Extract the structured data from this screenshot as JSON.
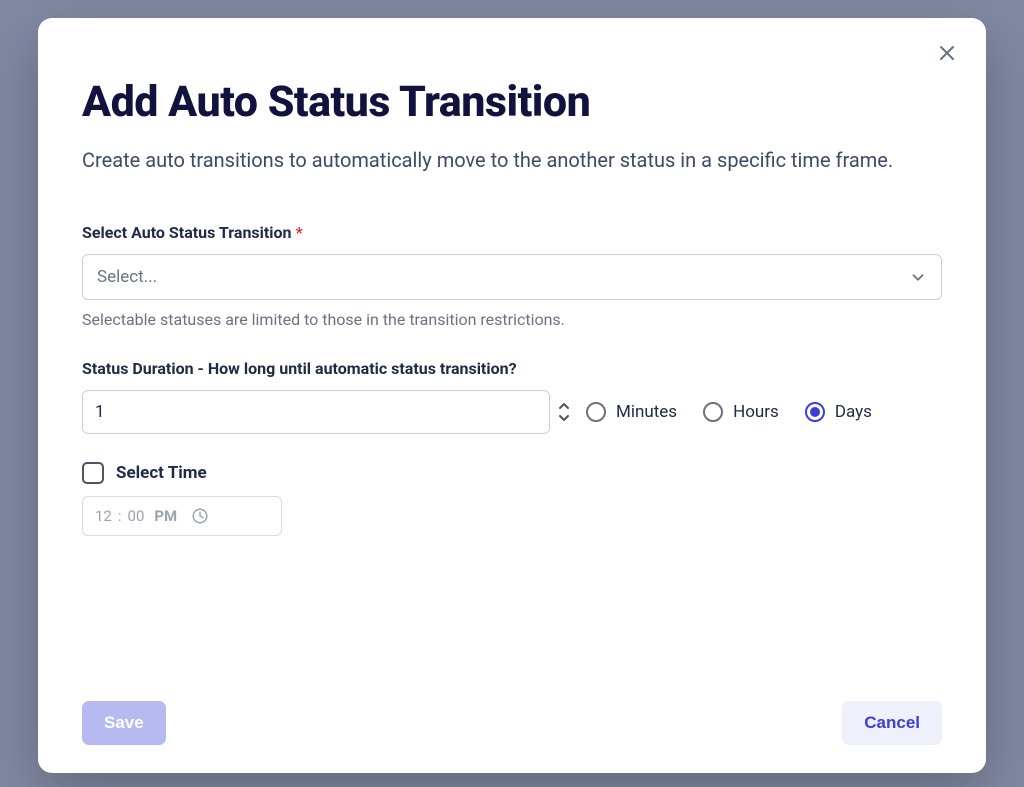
{
  "modal": {
    "title": "Add Auto Status Transition",
    "subtitle": "Create auto transitions to automatically move to the another status in a specific time frame."
  },
  "status_select": {
    "label": "Select Auto Status Transition",
    "required_mark": "*",
    "placeholder": "Select...",
    "helper": "Selectable statuses are limited to those in the transition restrictions."
  },
  "duration": {
    "label": "Status Duration - How long until automatic status transition?",
    "value": "1",
    "units": {
      "minutes": "Minutes",
      "hours": "Hours",
      "days": "Days",
      "selected": "days"
    }
  },
  "time": {
    "checkbox_label": "Select Time",
    "checked": false,
    "hour": "12",
    "separator": ":",
    "minute": "00",
    "meridiem": "PM"
  },
  "footer": {
    "save": "Save",
    "cancel": "Cancel"
  }
}
